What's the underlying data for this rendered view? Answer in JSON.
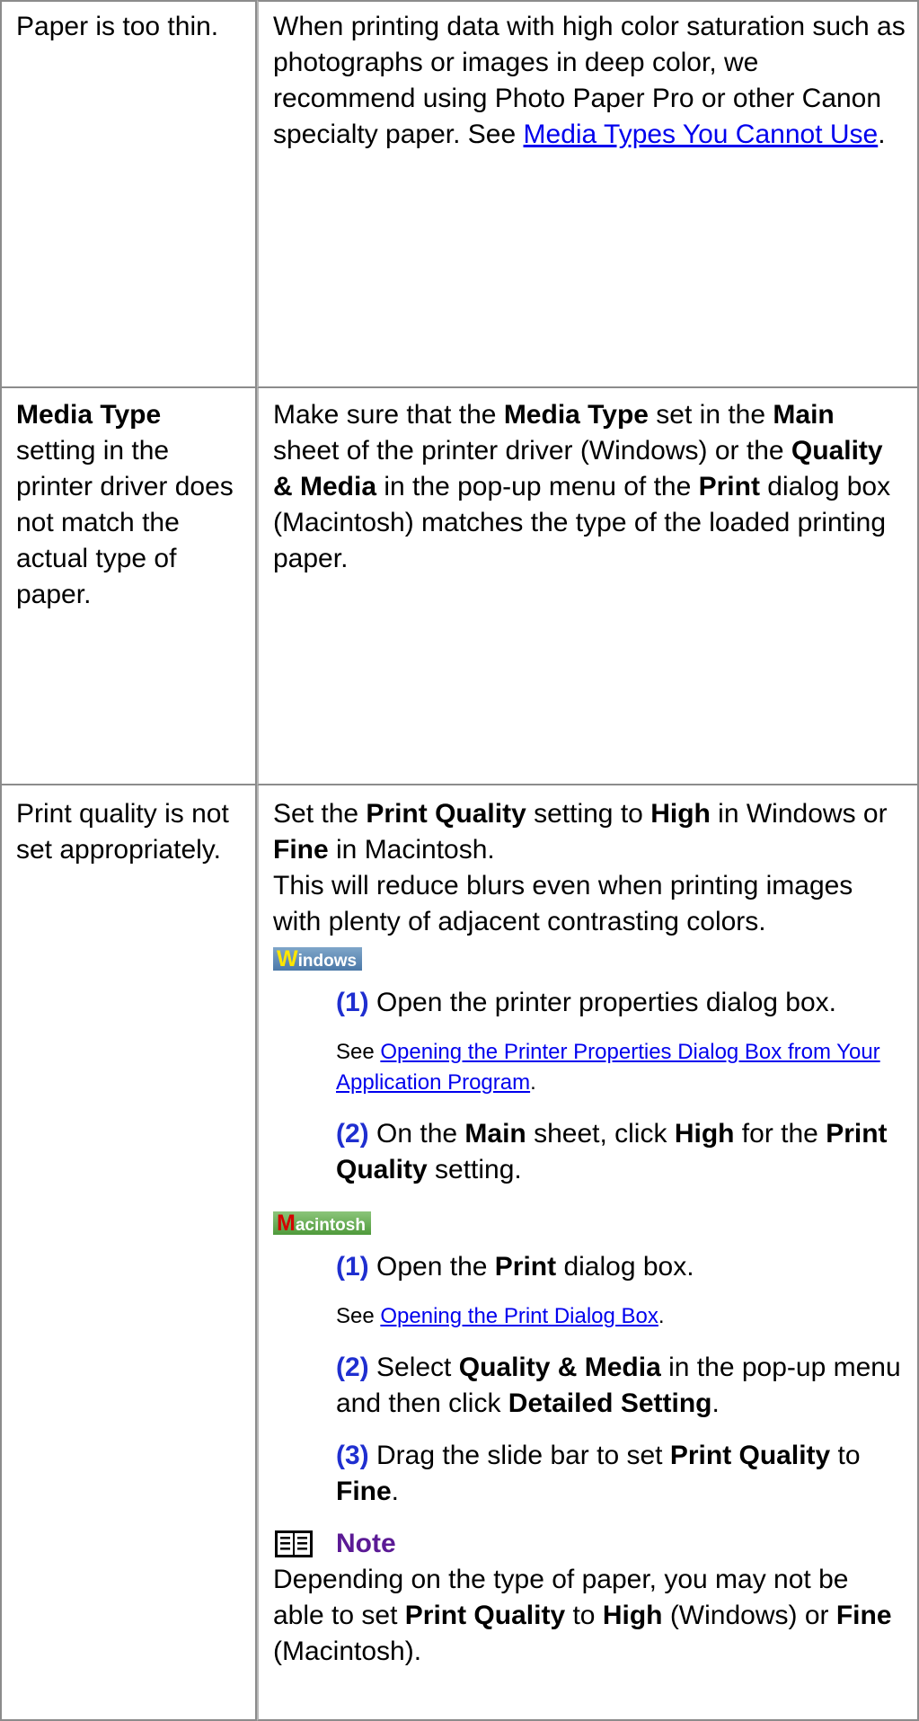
{
  "rows": [
    {
      "cause": "Paper is too thin.",
      "solution_text": "When printing data with high color saturation such as photographs or images in deep color, we recommend using Photo Paper Pro or other Canon specialty paper. See ",
      "solution_link": "Media Types You Cannot Use",
      "solution_end": "."
    },
    {
      "cause_bold": "Media Type",
      "cause_rest": " setting in the printer driver does not match the actual type of paper.",
      "s1": "Make sure that the ",
      "s1b": "Media Type",
      "s2": " set in the ",
      "s2b": "Main",
      "s3": " sheet of the printer driver (Windows) or the ",
      "s3b": "Quality & Media",
      "s4": " in the pop-up menu of the ",
      "s4b": "Print",
      "s5": " dialog box (Macintosh) matches the type of the loaded printing paper."
    },
    {
      "cause": "Print quality is not set appropriately.",
      "p1": "Set the ",
      "p1b": "Print Quality",
      "p2": " setting to ",
      "p2b": "High",
      "p3": " in Windows or ",
      "p3b": "Fine",
      "p4": " in Macintosh.",
      "p5": "This will reduce blurs even when printing images with plenty of adjacent contrasting colors.",
      "windows_badge_first": "W",
      "windows_badge_rest": "indows",
      "win_step1_num": "(1)",
      "win_step1": " Open the printer properties dialog box.",
      "win_see": "See ",
      "win_see_link": "Opening the Printer Properties Dialog Box from Your Application Program",
      "win_see_end": ".",
      "win_step2_num": "(2)",
      "win_step2a": " On the ",
      "win_step2b": "Main",
      "win_step2c": " sheet, click ",
      "win_step2d": "High",
      "win_step2e": " for the ",
      "win_step2f": "Print Quality",
      "win_step2g": " setting.",
      "mac_badge_first": "M",
      "mac_badge_rest": "acintosh",
      "mac_step1_num": "(1)",
      "mac_step1a": " Open the ",
      "mac_step1b": "Print",
      "mac_step1c": " dialog box.",
      "mac_see": "See ",
      "mac_see_link": "Opening the Print Dialog Box",
      "mac_see_end": ".",
      "mac_step2_num": "(2)",
      "mac_step2a": " Select ",
      "mac_step2b": "Quality & Media",
      "mac_step2c": " in the pop-up menu and then click ",
      "mac_step2d": "Detailed Setting",
      "mac_step2e": ".",
      "mac_step3_num": "(3)",
      "mac_step3a": " Drag the slide bar to set ",
      "mac_step3b": "Print Quality",
      "mac_step3c": " to ",
      "mac_step3d": "Fine",
      "mac_step3e": ".",
      "note_title": "Note",
      "note1": "Depending on the type of paper, you may not be able to set ",
      "note1b": "Print Quality",
      "note2": " to ",
      "note2b": "High",
      "note3": " (Windows) or ",
      "note3b": "Fine",
      "note4": " (Macintosh)."
    }
  ]
}
